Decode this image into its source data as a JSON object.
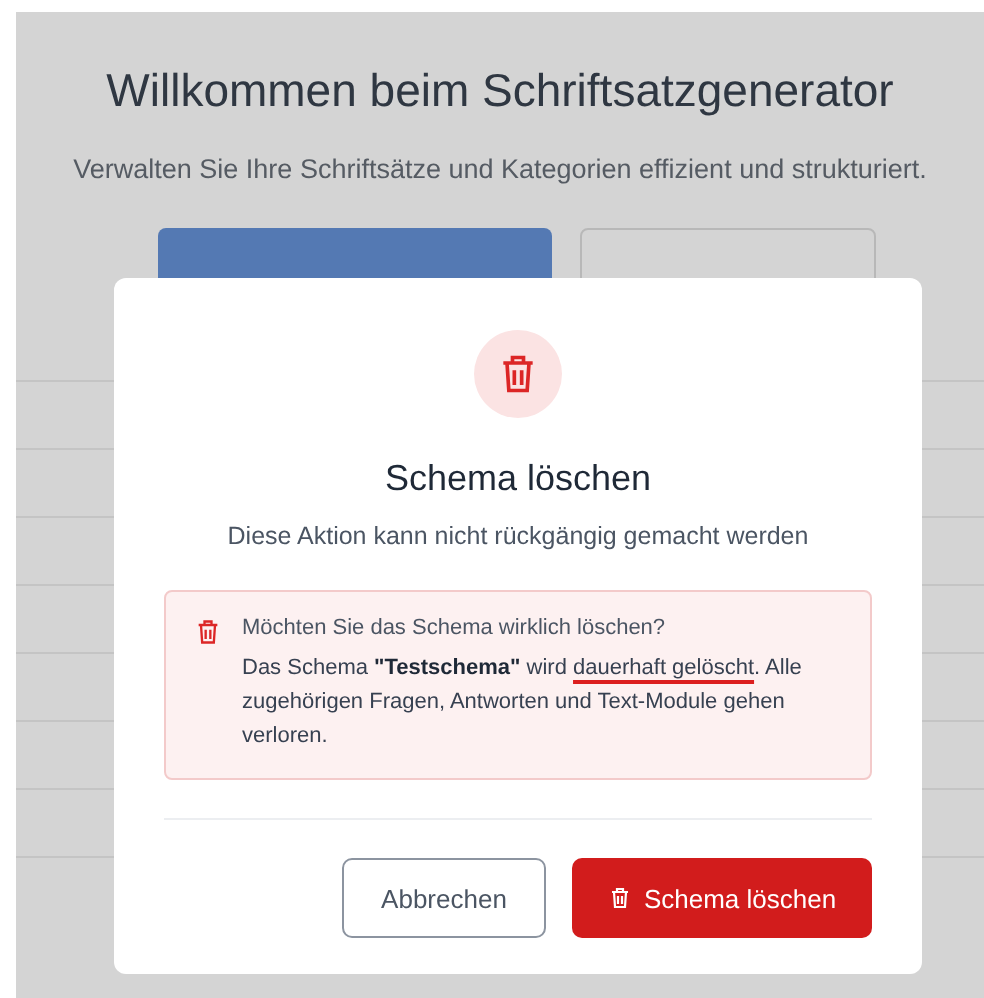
{
  "page": {
    "title": "Willkommen beim Schriftsatzgenerator",
    "subtitle": "Verwalten Sie Ihre Schriftsätze und Kategorien effizient und strukturiert."
  },
  "dialog": {
    "title": "Schema löschen",
    "subtitle": "Diese Aktion kann nicht rückgängig gemacht werden",
    "warning": {
      "question": "Möchten Sie das Schema wirklich löschen?",
      "body": [
        {
          "text": "Das Schema ",
          "kind": "plain"
        },
        {
          "text": "\"Testschema\"",
          "kind": "bold"
        },
        {
          "text": " wird ",
          "kind": "plain"
        },
        {
          "text": "dauerhaft gelöscht",
          "kind": "underline"
        },
        {
          "text": ". Alle zugehörigen Fragen, Antworten und Text-Module gehen verloren.",
          "kind": "plain"
        }
      ]
    },
    "buttons": [
      {
        "label": "Abbrechen",
        "kind": "secondary"
      },
      {
        "label": "Schema löschen",
        "kind": "danger"
      }
    ]
  }
}
